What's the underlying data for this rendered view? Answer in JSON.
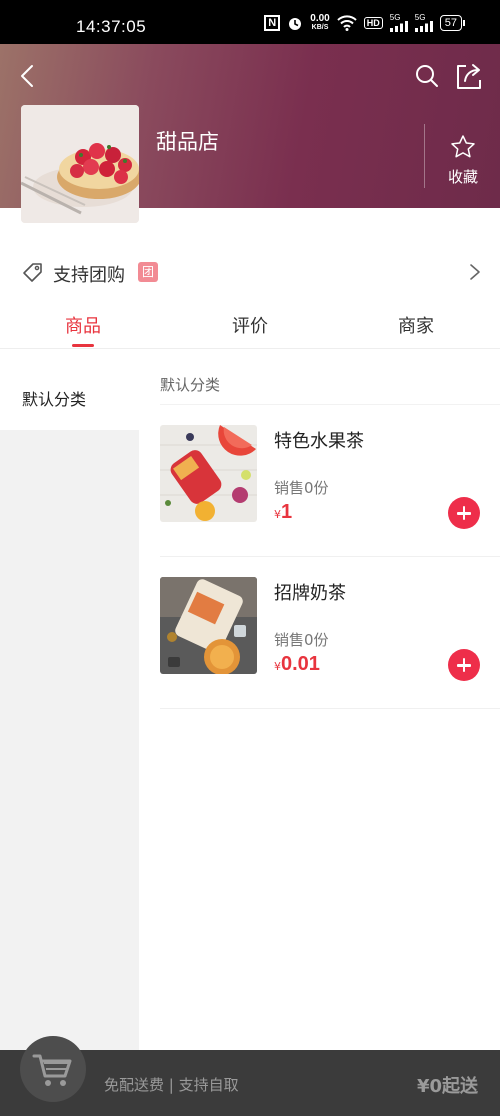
{
  "status_bar": {
    "time": "14:37:05",
    "speed_value": "0.00",
    "speed_unit": "KB/S",
    "hd_label": "HD",
    "signal_1": "5G",
    "signal_2": "5G",
    "battery": "57"
  },
  "header": {
    "store_name": "甜品店",
    "favorite_label": "收藏",
    "icons": [
      "back-arrow-icon",
      "search-icon",
      "share-icon",
      "star-icon"
    ]
  },
  "group_buy": {
    "label": "支持团购",
    "badge": "团"
  },
  "tabs": [
    {
      "label": "商品",
      "active": true
    },
    {
      "label": "评价",
      "active": false
    },
    {
      "label": "商家",
      "active": false
    }
  ],
  "sidebar": {
    "items": [
      {
        "label": "默认分类",
        "selected": true
      }
    ]
  },
  "category": {
    "title": "默认分类"
  },
  "products": [
    {
      "name": "特色水果茶",
      "sales": "销售0份",
      "currency": "¥",
      "price": "1"
    },
    {
      "name": "招牌奶茶",
      "sales": "销售0份",
      "currency": "¥",
      "price": "0.01"
    }
  ],
  "bottom_bar": {
    "delivery_info": "免配送费 | 支持自取",
    "min_order": "¥0起送"
  },
  "colors": {
    "accent": "#e8343e",
    "add_button": "#ee2e4a",
    "bottom_bar": "#3b3b3b",
    "header_gradient_start": "#9c7268",
    "header_gradient_end": "#6e2b4a"
  }
}
